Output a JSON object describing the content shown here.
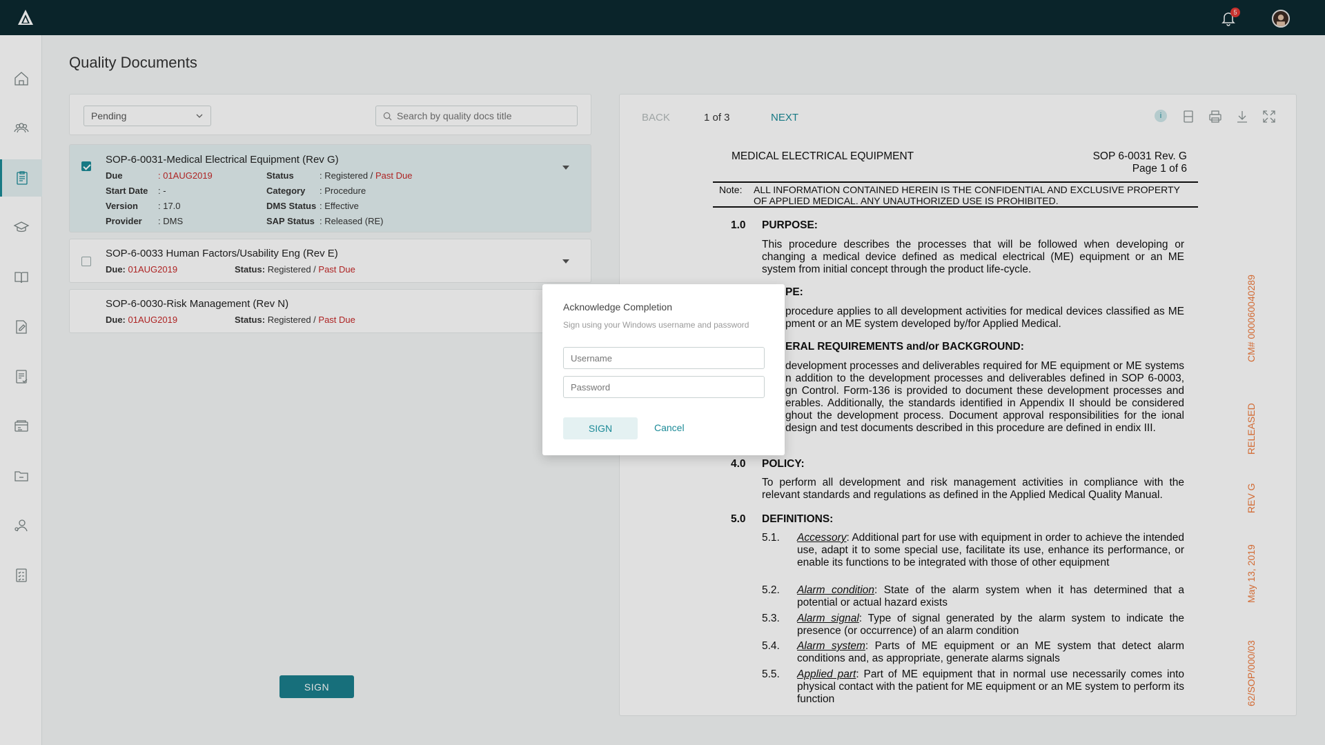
{
  "header": {
    "notification_count": "5"
  },
  "sidebar": {
    "items": [
      {
        "icon": "home-icon"
      },
      {
        "icon": "team-icon"
      },
      {
        "icon": "documents-icon"
      },
      {
        "icon": "training-icon"
      },
      {
        "icon": "book-icon"
      },
      {
        "icon": "edit-document-icon"
      },
      {
        "icon": "review-icon"
      },
      {
        "icon": "records-icon"
      },
      {
        "icon": "folder-icon"
      },
      {
        "icon": "user-settings-icon"
      },
      {
        "icon": "checklist-icon"
      }
    ]
  },
  "page": {
    "title": "Quality Documents"
  },
  "filters": {
    "status_selected": "Pending",
    "search_placeholder": "Search by quality docs title"
  },
  "docs": [
    {
      "title": "SOP-6-0031-Medical Electrical Equipment (Rev G)",
      "due_label": "Due",
      "due_value": ": 01AUG2019",
      "start_label": "Start Date",
      "start_value": ": -",
      "version_label": "Version",
      "version_value": ": 17.0",
      "provider_label": "Provider",
      "provider_value": ": DMS",
      "status_label": "Status",
      "status_value": ": Registered /",
      "status_flag": "Past Due",
      "category_label": "Category",
      "category_value": ": Procedure",
      "dms_label": "DMS Status",
      "dms_value": ": Effective",
      "sap_label": "SAP Status",
      "sap_value": ": Released (RE)"
    },
    {
      "title": "SOP-6-0033 Human Factors/Usability Eng (Rev E)",
      "due_label": "Due:",
      "due_value": "01AUG2019",
      "status_label": "Status:",
      "status_value": "Registered /",
      "status_flag": "Past Due"
    },
    {
      "title": "SOP-6-0030-Risk Management (Rev N)",
      "due_label": "Due:",
      "due_value": "01AUG2019",
      "status_label": "Status:",
      "status_value": "Registered /",
      "status_flag": "Past Due"
    }
  ],
  "actions": {
    "sign_label": "SIGN"
  },
  "viewer": {
    "back_label": "BACK",
    "page_indicator": "1 of 3",
    "next_label": "NEXT",
    "info_label": "i",
    "document": {
      "header_title": "MEDICAL ELECTRICAL EQUIPMENT",
      "header_sop": "SOP 6-0031 Rev. G",
      "header_page": "Page 1 of 6",
      "note_label": "Note:",
      "note_text": "ALL INFORMATION CONTAINED HEREIN IS THE CONFIDENTIAL AND EXCLUSIVE PROPERTY OF APPLIED MEDICAL. ANY UNAUTHORIZED USE IS PROHIBITED.",
      "s1_num": "1.0",
      "s1_title": "PURPOSE:",
      "s1_text": "This procedure describes the processes that will be followed when developing or changing a medical device defined as medical electrical (ME) equipment or an ME system from initial concept through the product life-cycle.",
      "s2_title": "PE:",
      "s2_text": "procedure applies to all development activities for medical devices classified as ME pment or an ME system developed by/for Applied Medical.",
      "s3_title": "ERAL REQUIREMENTS and/or BACKGROUND:",
      "s3_text": "development processes and deliverables required for ME equipment or ME systems n addition to the development processes and deliverables defined in SOP 6-0003, gn Control. Form-136 is provided to document these development processes and erables. Additionally, the standards identified in Appendix II should be considered ghout the development process. Document approval responsibilities for the ional design and test documents described in this procedure are defined in endix III.",
      "s4_num": "4.0",
      "s4_title": "POLICY:",
      "s4_text": "To perform all development and risk management activities in compliance with the relevant standards and regulations as defined in the Applied Medical Quality Manual.",
      "s5_num": "5.0",
      "s5_title": "DEFINITIONS:",
      "defs": [
        {
          "num": "5.1.",
          "term": "Accessory",
          "text": ": Additional part for use with equipment in order to achieve the intended use, adapt it to some special use, facilitate its use, enhance its performance, or enable its functions to be integrated with those of other equipment"
        },
        {
          "num": "5.2.",
          "term": "Alarm condition",
          "text": ": State of the alarm system when it has determined that a potential or actual hazard exists"
        },
        {
          "num": "5.3.",
          "term": "Alarm signal",
          "text": ": Type of signal generated by the alarm system to indicate the presence (or occurrence) of an alarm condition"
        },
        {
          "num": "5.4.",
          "term": "Alarm system",
          "text": ": Parts of ME equipment or an ME system that detect alarm conditions and, as appropriate, generate alarms signals"
        },
        {
          "num": "5.5.",
          "term": "Applied part",
          "text": ": Part of ME equipment that in normal use necessarily comes into physical contact with the patient for ME equipment or an ME system to perform its function"
        }
      ],
      "stamps": [
        "CM# 000060040289",
        "RELEASED",
        "REV G",
        "May 13, 2019",
        "62/SOP/000/03"
      ]
    }
  },
  "modal": {
    "title": "Acknowledge Completion",
    "subtitle": "Sign using your Windows username and password",
    "username_placeholder": "Username",
    "password_placeholder": "Password",
    "sign_label": "SIGN",
    "cancel_label": "Cancel"
  }
}
